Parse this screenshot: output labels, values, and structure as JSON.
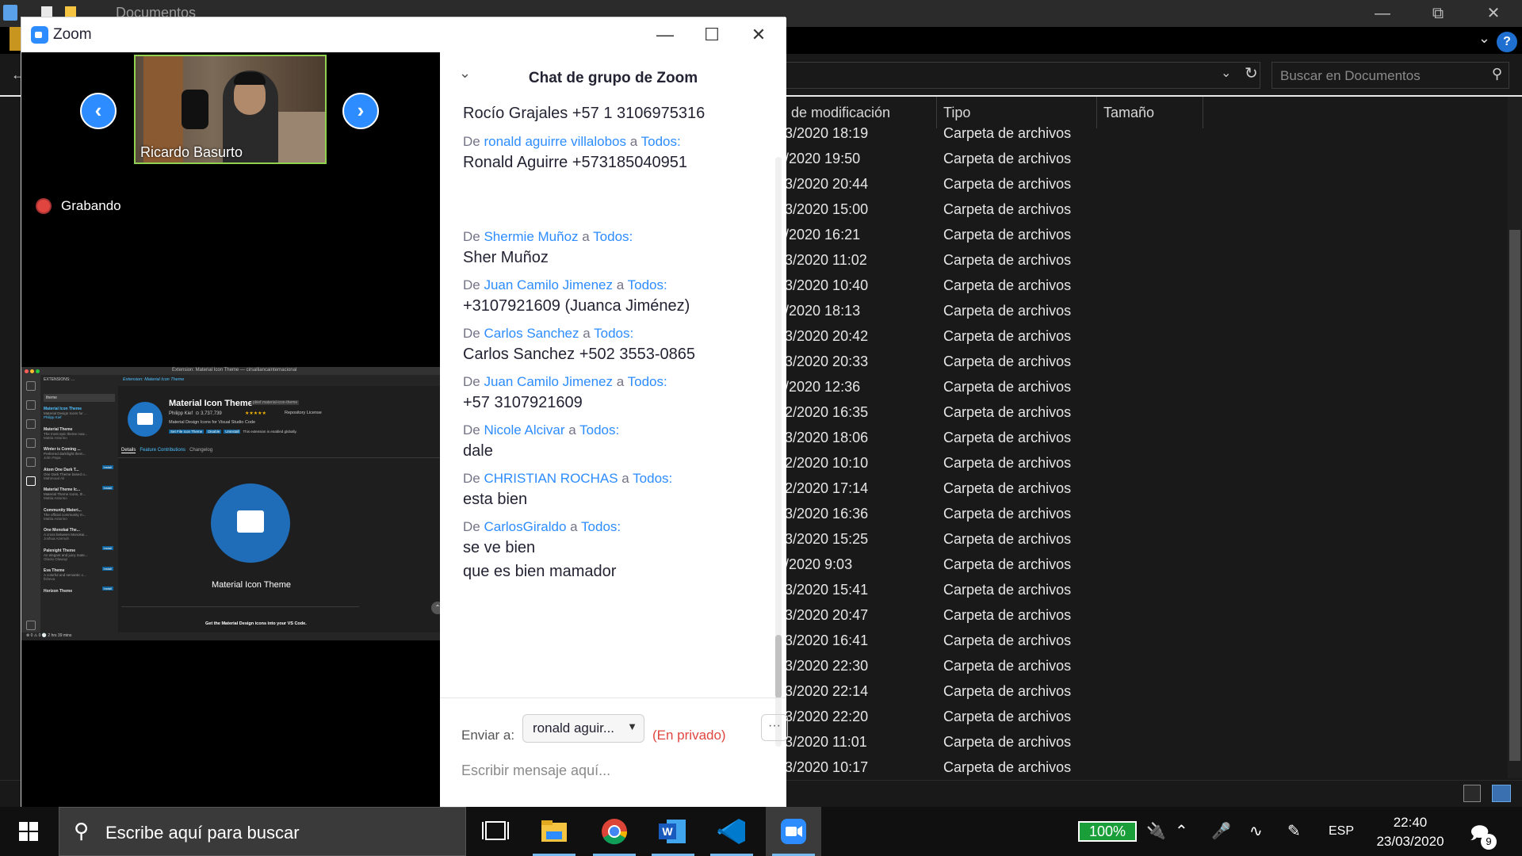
{
  "explorer": {
    "title": "Documentos",
    "search_placeholder": "Buscar en Documentos",
    "columns": [
      "de modificación",
      "Tipo",
      "Tamaño"
    ],
    "rows": [
      {
        "date": "3/2020 18:19",
        "type": "Carpeta de archivos"
      },
      {
        "date": "/2020 19:50",
        "type": "Carpeta de archivos"
      },
      {
        "date": "3/2020 20:44",
        "type": "Carpeta de archivos"
      },
      {
        "date": "3/2020 15:00",
        "type": "Carpeta de archivos"
      },
      {
        "date": "/2020 16:21",
        "type": "Carpeta de archivos"
      },
      {
        "date": "3/2020 11:02",
        "type": "Carpeta de archivos"
      },
      {
        "date": "3/2020 10:40",
        "type": "Carpeta de archivos"
      },
      {
        "date": "/2020 18:13",
        "type": "Carpeta de archivos"
      },
      {
        "date": "3/2020 20:42",
        "type": "Carpeta de archivos"
      },
      {
        "date": "3/2020 20:33",
        "type": "Carpeta de archivos"
      },
      {
        "date": "/2020 12:36",
        "type": "Carpeta de archivos"
      },
      {
        "date": "2/2020 16:35",
        "type": "Carpeta de archivos"
      },
      {
        "date": "3/2020 18:06",
        "type": "Carpeta de archivos"
      },
      {
        "date": "2/2020 10:10",
        "type": "Carpeta de archivos"
      },
      {
        "date": "2/2020 17:14",
        "type": "Carpeta de archivos"
      },
      {
        "date": "3/2020 16:36",
        "type": "Carpeta de archivos"
      },
      {
        "date": "3/2020 15:25",
        "type": "Carpeta de archivos"
      },
      {
        "date": "/2020 9:03",
        "type": "Carpeta de archivos"
      },
      {
        "date": "3/2020 15:41",
        "type": "Carpeta de archivos"
      },
      {
        "date": "3/2020 20:47",
        "type": "Carpeta de archivos"
      },
      {
        "date": "3/2020 16:41",
        "type": "Carpeta de archivos"
      },
      {
        "date": "3/2020 22:30",
        "type": "Carpeta de archivos"
      },
      {
        "date": "3/2020 22:14",
        "type": "Carpeta de archivos"
      },
      {
        "date": "3/2020 22:20",
        "type": "Carpeta de archivos"
      },
      {
        "date": "3/2020 11:01",
        "type": "Carpeta de archivos"
      },
      {
        "date": "3/2020 10:17",
        "type": "Carpeta de archivos"
      }
    ]
  },
  "zoom": {
    "window_title": "Zoom",
    "participant_name": "Ricardo Basurto",
    "recording_label": "Grabando",
    "shared_screen": {
      "window_title": "Extension: Material Icon Theme — cirsalliancainternacional",
      "sidebar_header": "EXTENSIONS: ...",
      "search_value": "theme",
      "tab_title": "Extension: Material Icon Theme",
      "ext_name": "Material Icon Theme",
      "ext_id": "pkief.material-icon-theme",
      "author": "Philipp Kief",
      "downloads": "3,737,739",
      "links": "Repository    License",
      "description": "Material Design Icons for Visual Studio Code",
      "buttons": [
        "Set File Icon Theme",
        "Disable",
        "Uninstall"
      ],
      "enabled_note": "This extension is enabled globally.",
      "nav": [
        "Details",
        "Feature Contributions",
        "Changelog"
      ],
      "caption": "Material Icon Theme",
      "tagline": "Get the Material Design icons into your VS Code.",
      "status": "⊗ 0  ⚠ 0    🕑 2 hrs 39 mins",
      "extensions": [
        {
          "name": "Material Icon Theme",
          "desc": "Material Design Icons for ...",
          "author": "Philipp Kief"
        },
        {
          "name": "Material Theme",
          "desc": "The most epic theme now...",
          "author": "Mattia Astorino"
        },
        {
          "name": "Winter is Coming ...",
          "desc": "Preferred dark/light them...",
          "author": "John Papa"
        },
        {
          "name": "Atom One Dark T...",
          "desc": "One Dark Theme based o...",
          "author": "Mahmoud Ali"
        },
        {
          "name": "Material Theme Ic...",
          "desc": "Material Theme Icons, th...",
          "author": "Mattia Astorino"
        },
        {
          "name": "Community Materi...",
          "desc": "The official community m...",
          "author": "Mattia Astorino"
        },
        {
          "name": "One Monokai The...",
          "desc": "A cross between Monokai...",
          "author": "Joshua Azemoh"
        },
        {
          "name": "Palenight Theme",
          "desc": "An elegant and juicy mate...",
          "author": "Olaolu Olawuyi"
        },
        {
          "name": "Eva Theme",
          "desc": "A colorful and semantic c...",
          "author": "fisheva"
        },
        {
          "name": "Horizon Theme",
          "desc": "",
          "author": ""
        }
      ],
      "install_label": "Install"
    },
    "chat": {
      "title": "Chat de grupo de Zoom",
      "partial_top": "Rocío Grajales    +57 1 3106975316",
      "from_word": "De",
      "to_word": "a",
      "messages": [
        {
          "sender": "ronald aguirre villalobos",
          "recipient": "Todos:",
          "lines": [
            "Ronald Aguirre +573185040951"
          ]
        },
        {
          "sender": "Shermie Muñoz",
          "recipient": "Todos:",
          "lines": [
            "Sher Muñoz"
          ]
        },
        {
          "sender": "Juan Camilo Jimenez",
          "recipient": "Todos:",
          "lines": [
            "+3107921609 (Juanca Jiménez)"
          ]
        },
        {
          "sender": "Carlos Sanchez",
          "recipient": "Todos:",
          "lines": [
            "Carlos Sanchez +502 3553-0865"
          ]
        },
        {
          "sender": "Juan Camilo Jimenez",
          "recipient": "Todos:",
          "lines": [
            "+57 3107921609"
          ]
        },
        {
          "sender": "Nicole Alcivar",
          "recipient": "Todos:",
          "lines": [
            "dale"
          ]
        },
        {
          "sender": "CHRISTIAN ROCHAS",
          "recipient": "Todos:",
          "lines": [
            "esta bien"
          ]
        },
        {
          "sender": "CarlosGiraldo",
          "recipient": "Todos:",
          "lines": [
            "se ve bien",
            "que es bien mamador"
          ]
        }
      ],
      "send_to_label": "Enviar a:",
      "recipient_selected": "ronald aguir...",
      "private_label": "(En privado)",
      "more_label": "···",
      "input_placeholder": "Escribir mensaje aquí..."
    }
  },
  "taskbar": {
    "search_text": "Escribe aquí para buscar",
    "battery": "100%",
    "language": "ESP",
    "time": "22:40",
    "date": "23/03/2020",
    "notification_count": "9"
  }
}
